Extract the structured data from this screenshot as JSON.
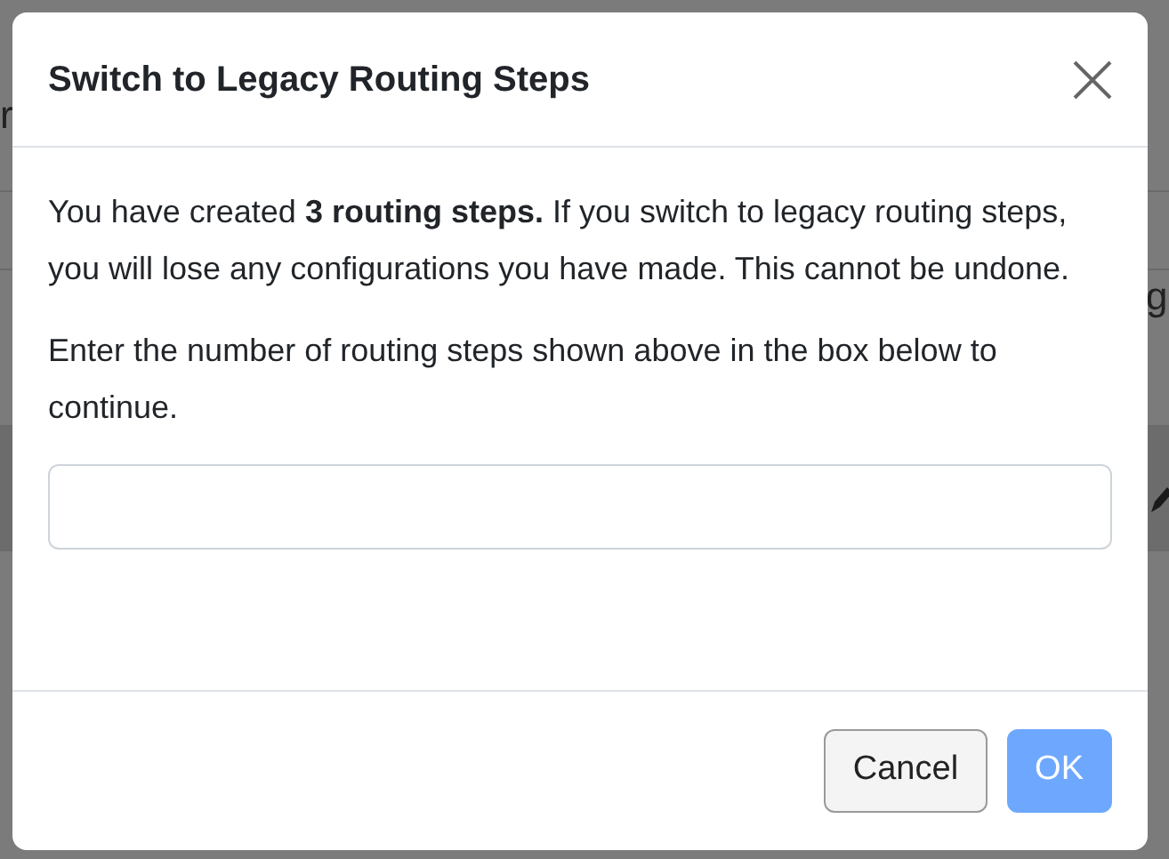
{
  "background": {
    "left_fragment": "r",
    "right_fragment": "g"
  },
  "dialog": {
    "title": "Switch to Legacy Routing Steps",
    "paragraphs": [
      "You have created **3 routing steps.** If you switch to legacy routing steps, you will lose any configurations you have made. This cannot be undone.",
      "Enter the number of routing steps shown above in the box below to continue."
    ],
    "buttons": [
      {
        "label": "Cancel",
        "kind": "secondary",
        "disabled": false
      },
      {
        "label": "OK",
        "kind": "primary",
        "disabled": true
      }
    ]
  }
}
